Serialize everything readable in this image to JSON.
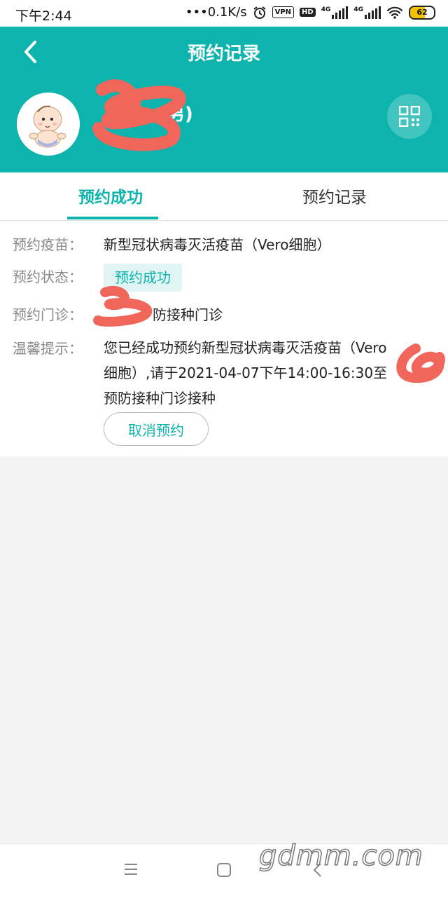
{
  "status_bar": {
    "time": "下午2:44",
    "network_speed": "•••0.1K/s",
    "vpn": "VPN",
    "hd": "HD",
    "network_1": "4G",
    "network_2": "4G",
    "battery": "62"
  },
  "header": {
    "title": "预约记录",
    "patient_name_suffix": "(男)"
  },
  "tabs": [
    {
      "label": "预约成功",
      "active": true
    },
    {
      "label": "预约记录",
      "active": false
    }
  ],
  "appointment": {
    "vaccine_label": "预约疫苗：",
    "vaccine_value": "新型冠状病毒灭活疫苗（Vero细胞）",
    "status_label": "预约状态：",
    "status_value": "预约成功",
    "clinic_label": "预约门诊：",
    "clinic_value": "防接种门诊",
    "tip_label": "温馨提示：",
    "tip_line1": "您已经成功预约新型冠状病毒灭活疫苗（Vero",
    "tip_line2": "细胞）,请于2021-04-07下午14:00-16:30至",
    "tip_line3": "预防接种门诊接种",
    "cancel_label": "取消预约"
  },
  "watermark": "gdmm.com",
  "colors": {
    "accent": "#0db4ad",
    "scribble": "#f0665a",
    "badge_bg": "#e0f4f4"
  },
  "icons": [
    "back-arrow-icon",
    "qr-code-icon",
    "alarm-icon",
    "wifi-icon",
    "menu-icon",
    "home-icon",
    "back-nav-icon"
  ]
}
